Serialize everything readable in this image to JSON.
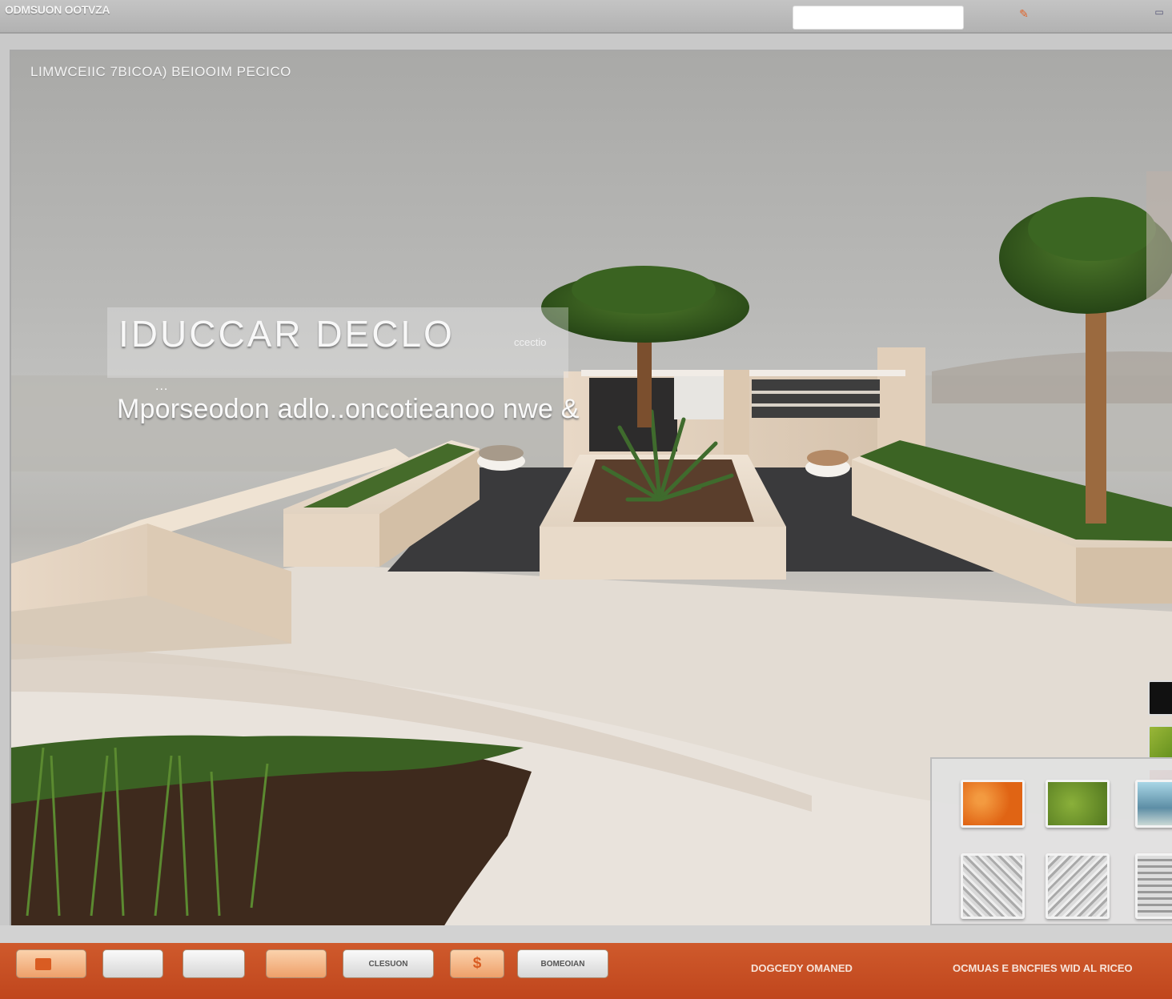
{
  "topbar": {
    "app_title": "ODMSUON OOTVZA",
    "search": {
      "value": "",
      "placeholder": ""
    },
    "tool_icon": "brush-icon",
    "window_icon": "window-icon"
  },
  "viewport": {
    "caption": "LIMWCEIIC 7BICOA) BEIOOIM PECICO",
    "hero_title": "IDUCCAR DECLO",
    "hero_tag": "ccectio",
    "hero_dots": "...",
    "hero_subtitle": "Mporseodon adlo..oncotieanoo nwe &"
  },
  "swatches": [
    {
      "name": "black",
      "color": "#111111"
    },
    {
      "name": "green",
      "color": "#7ea42c"
    },
    {
      "name": "red",
      "color": "#a83a36"
    }
  ],
  "material_panel": {
    "tiles": [
      {
        "name": "orange-gravel"
      },
      {
        "name": "moss"
      },
      {
        "name": "sky-water"
      },
      {
        "name": "stone-pattern-1"
      },
      {
        "name": "stone-pattern-2"
      },
      {
        "name": "stone-pattern-3"
      }
    ]
  },
  "toolbar": {
    "buttons": [
      {
        "label": "",
        "icon": "box-icon"
      },
      {
        "label": ""
      },
      {
        "label": ""
      },
      {
        "label": ""
      },
      {
        "label": "CLESUON"
      },
      {
        "label": "",
        "icon": "dollar-icon"
      },
      {
        "label": "BOMEOIAN"
      }
    ],
    "status_left": "DOGCEDY OMANED",
    "status_right": "OCMUAS E BNCFIES WID AL RICEO"
  },
  "colors": {
    "accent": "#c9501f",
    "planter": "#e3d5c4",
    "tile_dark": "#3a3a3c"
  }
}
